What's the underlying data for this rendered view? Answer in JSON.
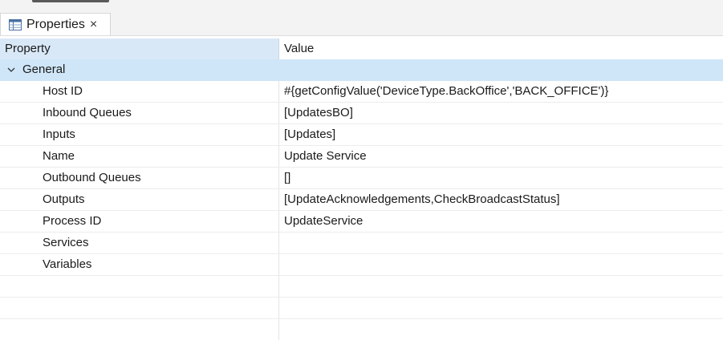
{
  "view": {
    "tab_label": "Properties",
    "tab_close": "×",
    "tab_icon": "table-icon"
  },
  "table": {
    "columns": [
      "Property",
      "Value"
    ],
    "group": {
      "label": "General",
      "expanded": true,
      "icon": "chevron-down-icon"
    },
    "rows": [
      {
        "property": "Host ID",
        "value": "#{getConfigValue('DeviceType.BackOffice','BACK_OFFICE')}"
      },
      {
        "property": "Inbound Queues",
        "value": "[UpdatesBO]"
      },
      {
        "property": "Inputs",
        "value": "[Updates]"
      },
      {
        "property": "Name",
        "value": "Update Service"
      },
      {
        "property": "Outbound Queues",
        "value": "[]"
      },
      {
        "property": "Outputs",
        "value": "[UpdateAcknowledgements,CheckBroadcastStatus]"
      },
      {
        "property": "Process ID",
        "value": "UpdateService"
      },
      {
        "property": "Services",
        "value": ""
      },
      {
        "property": "Variables",
        "value": ""
      }
    ]
  },
  "colors": {
    "header_highlight": "#d9e8f7",
    "group_row": "#cfe6f8"
  }
}
